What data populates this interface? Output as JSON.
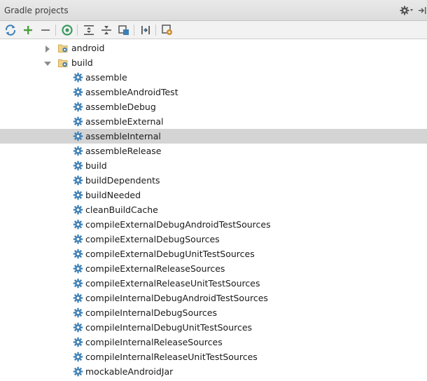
{
  "panel": {
    "title": "Gradle projects"
  },
  "toolbar": {
    "buttons": [
      {
        "icon": "refresh-icon"
      },
      {
        "icon": "add-icon"
      },
      {
        "icon": "remove-icon"
      },
      {
        "icon": "execute-task-icon"
      },
      {
        "icon": "expand-all-icon"
      },
      {
        "icon": "collapse-all-icon"
      },
      {
        "icon": "group-modules-icon"
      },
      {
        "icon": "offline-mode-icon"
      },
      {
        "icon": "gradle-settings-icon"
      }
    ]
  },
  "tree": {
    "nodes": [
      {
        "label": "android",
        "icon": "folder-gradle-icon",
        "expanded": false
      },
      {
        "label": "build",
        "icon": "folder-gradle-icon",
        "expanded": true
      }
    ],
    "tasks": [
      "assemble",
      "assembleAndroidTest",
      "assembleDebug",
      "assembleExternal",
      "assembleInternal",
      "assembleRelease",
      "build",
      "buildDependents",
      "buildNeeded",
      "cleanBuildCache",
      "compileExternalDebugAndroidTestSources",
      "compileExternalDebugSources",
      "compileExternalDebugUnitTestSources",
      "compileExternalReleaseSources",
      "compileExternalReleaseUnitTestSources",
      "compileInternalDebugAndroidTestSources",
      "compileInternalDebugSources",
      "compileInternalDebugUnitTestSources",
      "compileInternalReleaseSources",
      "compileInternalReleaseUnitTestSources",
      "mockableAndroidJar"
    ],
    "selected_task": "assembleInternal"
  },
  "colors": {
    "selection": "#d4d4d4",
    "gear": "#3d7fb5",
    "add": "#4a9e3f",
    "run": "#3a9a5e"
  }
}
